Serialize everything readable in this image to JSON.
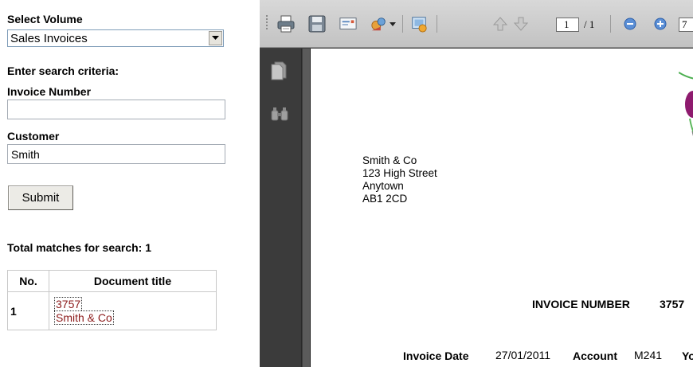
{
  "search": {
    "select_volume_label": "Select Volume",
    "volume_selected": "Sales Invoices",
    "criteria_label": "Enter search criteria:",
    "invoice_number_label": "Invoice Number",
    "invoice_number_value": "",
    "customer_label": "Customer",
    "customer_value": "Smith",
    "submit_label": "Submit",
    "total_matches_label": "Total matches for search: 1"
  },
  "results": {
    "columns": [
      "No.",
      "Document title"
    ],
    "rows": [
      {
        "no": "1",
        "title_line1": "3757",
        "title_line2": "Smith & Co"
      }
    ]
  },
  "viewer": {
    "toolbar_icons": [
      "print-icon",
      "save-icon",
      "email-icon",
      "share-icon",
      "export-icon",
      "previous-page-icon",
      "next-page-icon",
      "zoom-out-icon",
      "zoom-in-icon"
    ],
    "page_current": "1",
    "page_total": "/ 1",
    "zoom_value": "7",
    "side_icons": [
      "pages-icon",
      "search-binoculars-icon"
    ]
  },
  "invoice": {
    "address_lines": [
      "Smith & Co",
      "123 High Street",
      "Anytown",
      "AB1 2CD"
    ],
    "invoice_number_label": "INVOICE NUMBER",
    "invoice_number": "3757",
    "invoice_date_label": "Invoice Date",
    "invoice_date": "27/01/2011",
    "account_label": "Account",
    "account": "M241",
    "truncated_label": "Yo"
  },
  "colors": {
    "link": "#8b1a1a",
    "viewer_bg": "#3e3e3e",
    "toolbar_bg": "#cfcfcf"
  }
}
